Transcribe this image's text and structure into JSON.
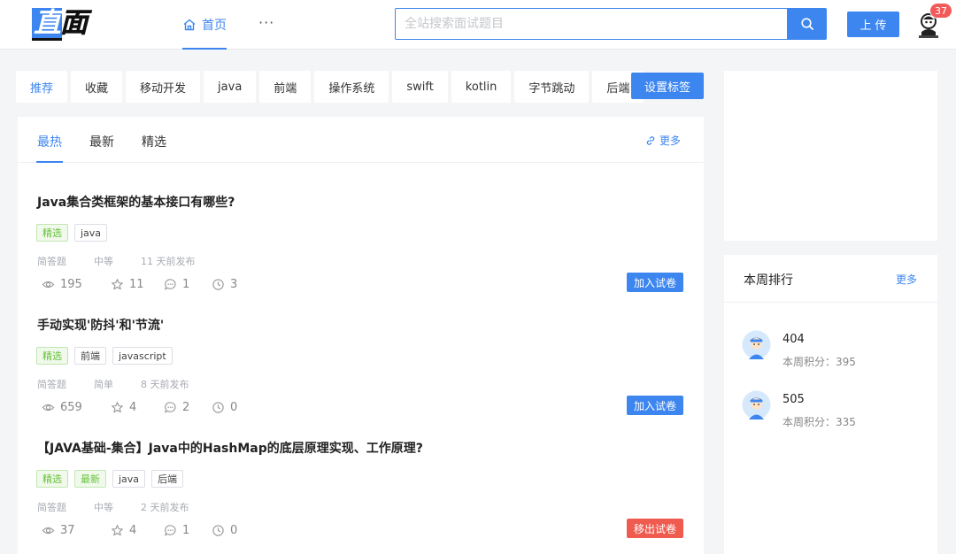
{
  "header": {
    "logo_text_left": "直",
    "logo_text_right": "面",
    "nav_home_label": "首页",
    "nav_more_label": "···",
    "search_placeholder": "全站搜索面试题目",
    "upload_label": "上传",
    "notification_count": "37"
  },
  "colors": {
    "accent": "#3d86f0",
    "danger": "#f05b4f",
    "success": "#67c23a"
  },
  "tagbar": {
    "tags": [
      "推荐",
      "收藏",
      "移动开发",
      "java",
      "前端",
      "操作系统",
      "swift",
      "kotlin",
      "字节跳动",
      "后端"
    ],
    "active_index": 0,
    "settings_label": "设置标签"
  },
  "main": {
    "tabs": [
      "最热",
      "最新",
      "精选"
    ],
    "active_tab": 0,
    "more_label": "更多",
    "questions": [
      {
        "title": "Java集合类框架的基本接口有哪些?",
        "tags": [
          {
            "label": "精选",
            "style": "green"
          },
          {
            "label": "java",
            "style": "plain"
          }
        ],
        "type": "简答题",
        "difficulty": "中等",
        "published": "11 天前发布",
        "views": "195",
        "stars": "11",
        "comments": "1",
        "history": "3",
        "action": "加入试卷",
        "action_style": "blue"
      },
      {
        "title": "手动实现'防抖'和'节流'",
        "tags": [
          {
            "label": "精选",
            "style": "green"
          },
          {
            "label": "前端",
            "style": "plain"
          },
          {
            "label": "javascript",
            "style": "plain"
          }
        ],
        "type": "简答题",
        "difficulty": "简单",
        "published": "8 天前发布",
        "views": "659",
        "stars": "4",
        "comments": "2",
        "history": "0",
        "action": "加入试卷",
        "action_style": "blue"
      },
      {
        "title": "【JAVA基础-集合】Java中的HashMap的底层原理实现、工作原理?",
        "tags": [
          {
            "label": "精选",
            "style": "green"
          },
          {
            "label": "最新",
            "style": "green"
          },
          {
            "label": "java",
            "style": "plain"
          },
          {
            "label": "后端",
            "style": "plain"
          }
        ],
        "type": "简答题",
        "difficulty": "中等",
        "published": "2 天前发布",
        "views": "37",
        "stars": "4",
        "comments": "1",
        "history": "0",
        "action": "移出试卷",
        "action_style": "red"
      }
    ]
  },
  "ranking": {
    "title": "本周排行",
    "more_label": "更多",
    "items": [
      {
        "name": "404",
        "score": "本周积分：395"
      },
      {
        "name": "505",
        "score": "本周积分：335"
      }
    ]
  }
}
